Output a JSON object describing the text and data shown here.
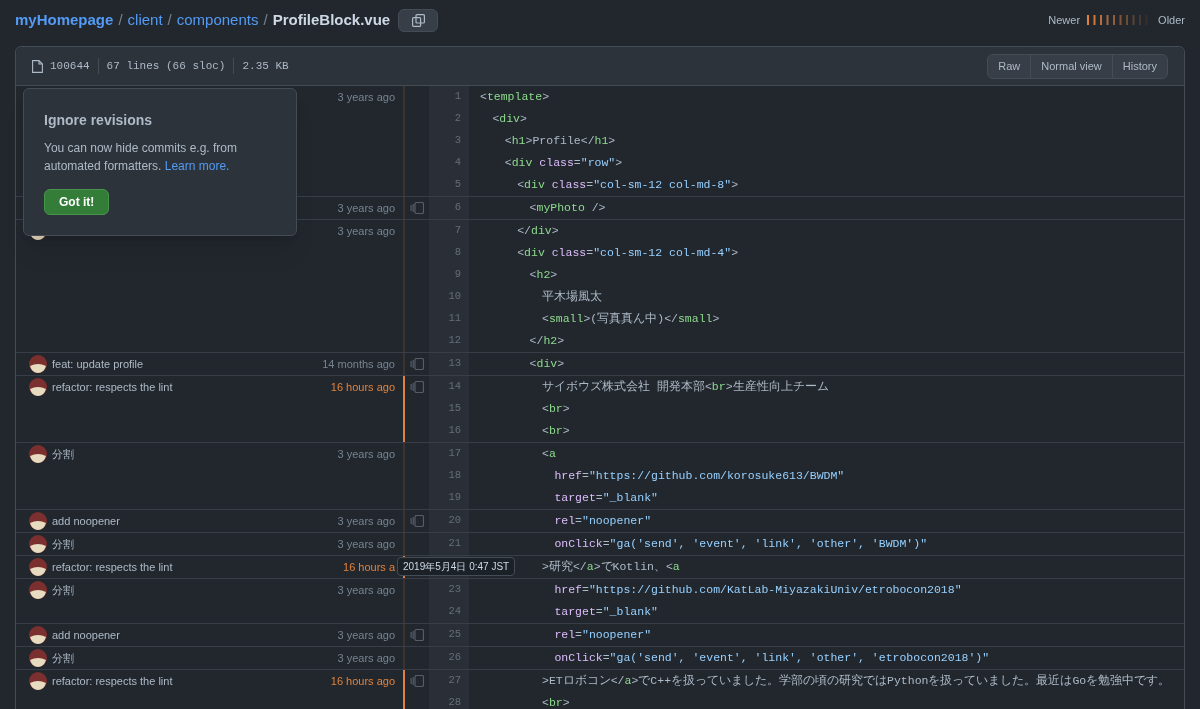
{
  "breadcrumb": [
    {
      "kind": "repo",
      "text": "myHomepage"
    },
    {
      "kind": "separator",
      "text": "/"
    },
    {
      "kind": "link",
      "text": "client"
    },
    {
      "kind": "separator",
      "text": "/"
    },
    {
      "kind": "link",
      "text": "components"
    },
    {
      "kind": "separator",
      "text": "/"
    },
    {
      "kind": "current",
      "text": "ProfileBlock.vue"
    }
  ],
  "heat_legend": {
    "newer": "Newer",
    "older": "Older"
  },
  "file_info": [
    "100644",
    "67 lines (66 sloc)",
    "2.35 KB"
  ],
  "view_buttons": [
    "Raw",
    "Normal view",
    "History"
  ],
  "popover": {
    "title": "Ignore revisions",
    "text": "You can now hide commits e.g. from automated formatters.",
    "link": "Learn more.",
    "button": "Got it!"
  },
  "hunks": [
    {
      "time": "3 years ago",
      "recent": false,
      "reblame": false,
      "lines": [
        {
          "number": "1",
          "code": "<template>"
        },
        {
          "number": "2",
          "code": "  <div>"
        },
        {
          "number": "3",
          "code": "    <h1>Profile</h1>"
        },
        {
          "number": "4",
          "code": "    <div class=\"row\">"
        },
        {
          "number": "5",
          "code": "      <div class=\"col-sm-12 col-md-8\">"
        }
      ]
    },
    {
      "time": "3 years ago",
      "recent": false,
      "reblame": true,
      "lines": [
        {
          "number": "6",
          "code": "        <myPhoto />"
        }
      ]
    },
    {
      "avatar": true,
      "time": "3 years ago",
      "recent": false,
      "reblame": false,
      "lines": [
        {
          "number": "7",
          "code": "      </div>"
        },
        {
          "number": "8",
          "code": "      <div class=\"col-sm-12 col-md-4\">"
        },
        {
          "number": "9",
          "code": "        <h2>"
        },
        {
          "number": "10",
          "code": "          平木場風太"
        },
        {
          "number": "11",
          "code": "          <small>(写真真ん中)</small>"
        },
        {
          "number": "12",
          "code": "        </h2>"
        }
      ]
    },
    {
      "message": "feat: update profile",
      "time": "14 months ago",
      "recent": false,
      "reblame": true,
      "lines": [
        {
          "number": "13",
          "code": "        <div>"
        }
      ]
    },
    {
      "message": "refactor: respects the lint",
      "time": "16 hours ago",
      "recent": true,
      "reblame": true,
      "lines": [
        {
          "number": "14",
          "code": "          サイボウズ株式会社 開発本部<br>生産性向上チーム"
        },
        {
          "number": "15",
          "code": "          <br>"
        },
        {
          "number": "16",
          "code": "          <br>"
        }
      ]
    },
    {
      "message": "分割",
      "time": "3 years ago",
      "recent": false,
      "reblame": false,
      "lines": [
        {
          "number": "17",
          "code": "          <a"
        },
        {
          "number": "18",
          "code": "            href=\"https://github.com/korosuke613/BWDM\""
        },
        {
          "number": "19",
          "code": "            target=\"_blank\""
        }
      ]
    },
    {
      "message": "add noopener",
      "time": "3 years ago",
      "recent": false,
      "reblame": true,
      "lines": [
        {
          "number": "20",
          "code": "            rel=\"noopener\""
        }
      ]
    },
    {
      "message": "分割",
      "time": "3 years ago",
      "recent": false,
      "reblame": false,
      "lines": [
        {
          "number": "21",
          "code": "            onClick=\"ga('send', 'event', 'link', 'other', 'BWDM')\""
        }
      ]
    },
    {
      "message": "refactor: respects the lint",
      "time": "16 hours a",
      "recent": true,
      "reblame": false,
      "tooltip": "2019年5月4日 0:47 JST",
      "lines": [
        {
          "code": "          >研究</a>でKotlin、<a"
        }
      ]
    },
    {
      "message": "分割",
      "time": "3 years ago",
      "recent": false,
      "reblame": false,
      "lines": [
        {
          "number": "23",
          "code": "            href=\"https://github.com/KatLab-MiyazakiUniv/etrobocon2018\""
        },
        {
          "number": "24",
          "code": "            target=\"_blank\""
        }
      ]
    },
    {
      "message": "add noopener",
      "time": "3 years ago",
      "recent": false,
      "reblame": true,
      "lines": [
        {
          "number": "25",
          "code": "            rel=\"noopener\""
        }
      ]
    },
    {
      "message": "分割",
      "time": "3 years ago",
      "recent": false,
      "reblame": false,
      "lines": [
        {
          "number": "26",
          "code": "            onClick=\"ga('send', 'event', 'link', 'other', 'etrobocon2018')\""
        }
      ]
    },
    {
      "message": "refactor: respects the lint",
      "time": "16 hours ago",
      "recent": true,
      "reblame": true,
      "lines": [
        {
          "number": "27",
          "code": "          >ETロボコン</a>でC++を扱っていました。学部の頃の研究ではPythonを扱っていました。最近はGoを勉強中です。"
        },
        {
          "number": "28",
          "code": "          <br>"
        }
      ]
    }
  ]
}
